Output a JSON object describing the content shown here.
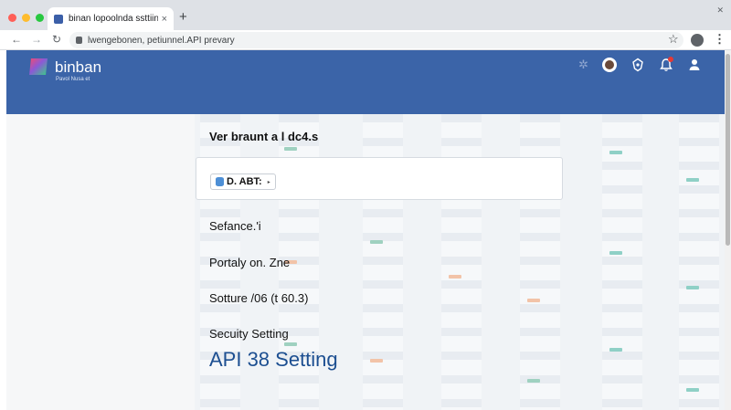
{
  "browser": {
    "tab_title": "binan lopoolnda ssttiing",
    "tab_close": "×",
    "new_tab": "+",
    "url": "lwengebonen, petiunnel.API prevary",
    "window_close": "✕"
  },
  "header": {
    "brand": "binban",
    "brand_sub": "Pavol Nusa et",
    "decor_glyph": "✲"
  },
  "main": {
    "section_title": "Ver braunt a l dc4.s",
    "selector_value": "D. ABT:",
    "selector_caret": "▸",
    "items": [
      "Sefance.'i",
      "Portaly on. Zne",
      "Sotture /06 (t 60.3)",
      "Secuity Setting",
      "API 38 Setting"
    ]
  },
  "colors": {
    "header_bg": "#3b64a8",
    "active_item": "#1d4f91",
    "tabstrip_bg": "#dee1e6"
  },
  "icons": [
    "back-arrow-icon",
    "forward-arrow-icon",
    "reload-icon",
    "lock-icon",
    "star-icon",
    "profile-icon",
    "kebab-menu-icon",
    "avatar-icon",
    "feedback-icon",
    "bell-icon",
    "user-icon",
    "database-icon"
  ]
}
